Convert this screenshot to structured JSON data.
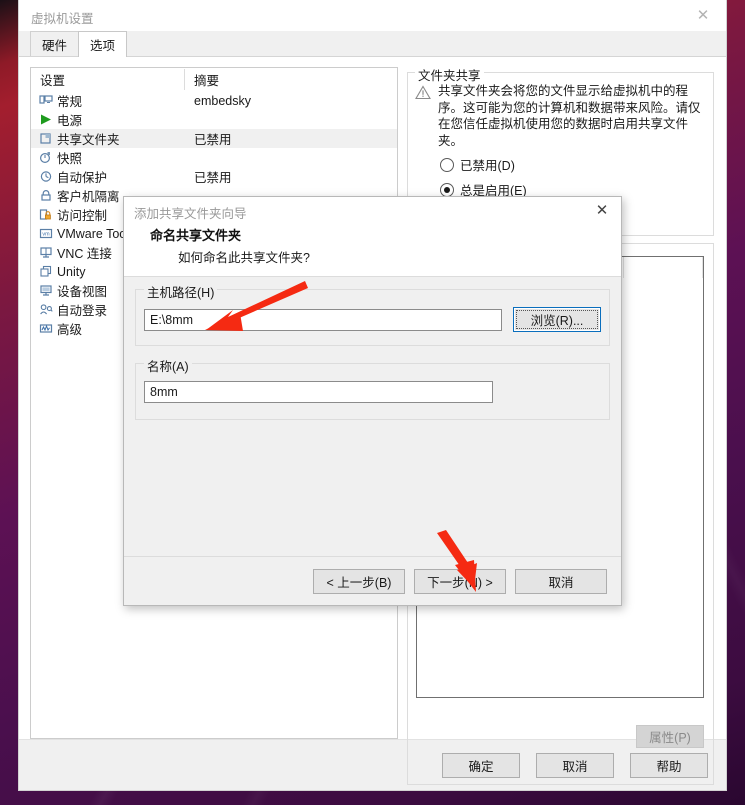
{
  "window": {
    "title": "虚拟机设置",
    "close_icon": "close-icon",
    "tabs": [
      {
        "label": "硬件",
        "active": false
      },
      {
        "label": "选项",
        "active": true
      }
    ],
    "footer_buttons": [
      {
        "label": "确定"
      },
      {
        "label": "取消"
      },
      {
        "label": "帮助"
      }
    ]
  },
  "settings_list": {
    "columns": [
      "设置",
      "摘要"
    ],
    "rows": [
      {
        "icon": "monitor-icon",
        "label": "常规",
        "summary": "embedsky",
        "selected": false
      },
      {
        "icon": "play-icon",
        "label": "电源",
        "summary": "",
        "selected": false
      },
      {
        "icon": "shared-folder-icon",
        "label": "共享文件夹",
        "summary": "已禁用",
        "selected": true
      },
      {
        "icon": "snapshot-icon",
        "label": "快照",
        "summary": "",
        "selected": false
      },
      {
        "icon": "autoprotect-icon",
        "label": "自动保护",
        "summary": "已禁用",
        "selected": false
      },
      {
        "icon": "lock-icon",
        "label": "客户机隔离",
        "summary": "",
        "selected": false
      },
      {
        "icon": "access-control-icon",
        "label": "访问控制",
        "summary": "",
        "selected": false
      },
      {
        "icon": "vmware-tools-icon",
        "label": "VMware Tools",
        "summary": "",
        "selected": false
      },
      {
        "icon": "vnc-icon",
        "label": "VNC 连接",
        "summary": "",
        "selected": false
      },
      {
        "icon": "unity-icon",
        "label": "Unity",
        "summary": "",
        "selected": false
      },
      {
        "icon": "device-view-icon",
        "label": "设备视图",
        "summary": "",
        "selected": false
      },
      {
        "icon": "autologon-icon",
        "label": "自动登录",
        "summary": "",
        "selected": false
      },
      {
        "icon": "advanced-icon",
        "label": "高级",
        "summary": "",
        "selected": false
      }
    ]
  },
  "share_group": {
    "legend": "文件夹共享",
    "warning_icon": "warning-triangle-icon",
    "warning_text": "共享文件夹会将您的文件显示给虚拟机中的程序。这可能为您的计算机和数据带来风险。请仅在您信任虚拟机使用您的数据时启用共享文件夹。",
    "options": [
      {
        "label": "已禁用(D)",
        "accel": "D",
        "selected": false
      },
      {
        "label": "总是启用(E)",
        "accel": "E",
        "selected": true
      }
    ]
  },
  "folders_group": {
    "properties_button": "属性(P)"
  },
  "modal": {
    "title": "添加共享文件夹向导",
    "close_icon": "close-icon",
    "heading": "命名共享文件夹",
    "subheading": "如何命名此共享文件夹?",
    "host_path": {
      "legend": "主机路径(H)",
      "accel": "H",
      "value": "E:\\8mm",
      "browse_label": "浏览(R)...",
      "browse_accel": "R"
    },
    "name": {
      "legend": "名称(A)",
      "accel": "A",
      "value": "8mm"
    },
    "buttons": [
      {
        "label": "< 上一步(B)"
      },
      {
        "label": "下一步(N) >"
      },
      {
        "label": "取消"
      }
    ]
  },
  "annotations": {
    "arrow_1": "red-arrow-to-host-path",
    "arrow_2": "red-arrow-to-next-button",
    "arrow_color": "#f52a12"
  }
}
